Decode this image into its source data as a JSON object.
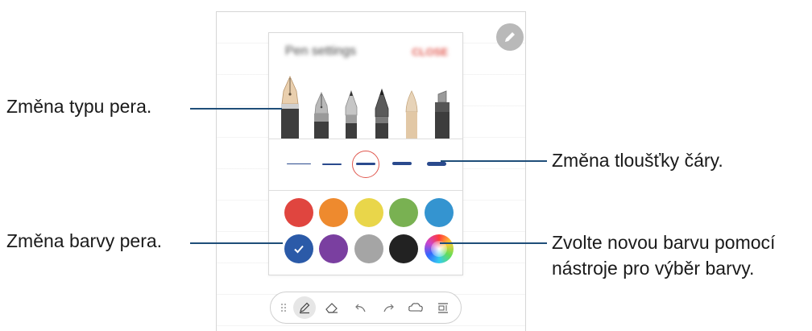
{
  "callouts": {
    "pen_type": "Změna typu pera.",
    "pen_color": "Změna barvy pera.",
    "line_thickness": "Změna tloušťky čáry.",
    "color_picker_line1": "Zvolte novou barvu pomocí",
    "color_picker_line2": "nástroje pro výběr barvy."
  },
  "colors": {
    "leader": "#1f4e79",
    "accent": "#e0574e",
    "stroke": "#2a4a8d",
    "swatches": [
      "#e0453f",
      "#ee8a2e",
      "#e9d64a",
      "#79b152",
      "#3494d0",
      "#2b5aa8",
      "#7a3fa0",
      "#a5a5a5",
      "#222222",
      "spectrum"
    ]
  },
  "selected_swatch": 6,
  "selected_thickness": 3,
  "toolbar": {
    "icons": [
      "drag-handle-icon",
      "pen-icon",
      "eraser-icon",
      "undo-icon",
      "redo-icon",
      "shape-icon",
      "text-format-icon"
    ]
  }
}
